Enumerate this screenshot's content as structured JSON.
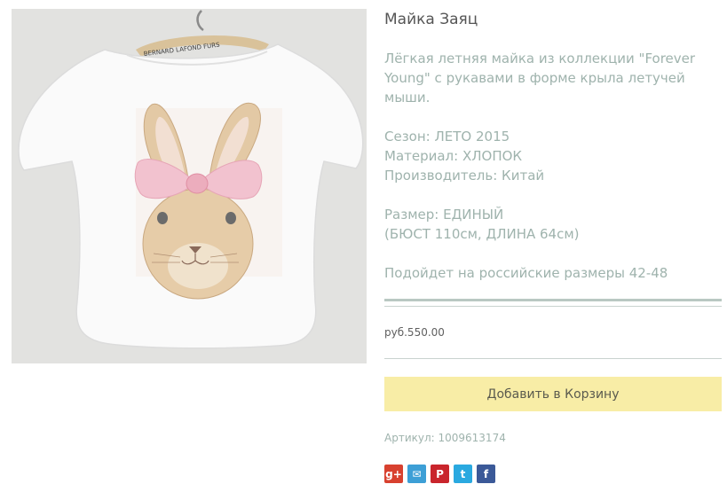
{
  "product": {
    "title": "Майка Заяц",
    "hanger_label": "BERNARD LAFOND FURS",
    "description": "Лёгкая летняя майка из коллекции \"Forever Young\" с рукавами в форме крыла летучей мыши.",
    "season": "Сезон: ЛЕТО 2015",
    "material": "Материал: ХЛОПОК",
    "manufacturer": "Производитель: Китай",
    "size": "Размер: ЕДИНЫЙ",
    "measurements": "(БЮСТ 110см, ДЛИНА 64см)",
    "fit_note": "Подойдет на российские размеры 42-48",
    "price": "руб.550.00",
    "add_to_cart": "Добавить в Корзину",
    "sku": "Артикул: 1009613174"
  },
  "social": [
    {
      "icon": "google-plus-icon",
      "glyph": "g+",
      "color": "#d8412f"
    },
    {
      "icon": "odnoklassniki-icon",
      "glyph": "✉",
      "color": "#3d9fd6"
    },
    {
      "icon": "pinterest-icon",
      "glyph": "P",
      "color": "#c9252c"
    },
    {
      "icon": "twitter-icon",
      "glyph": "t",
      "color": "#2aa9e0"
    },
    {
      "icon": "facebook-icon",
      "glyph": "f",
      "color": "#3b5998"
    }
  ],
  "colors": {
    "accent_button": "#f8eda6",
    "muted_text": "#9fb3ad",
    "rule": "#b9c8c2"
  }
}
